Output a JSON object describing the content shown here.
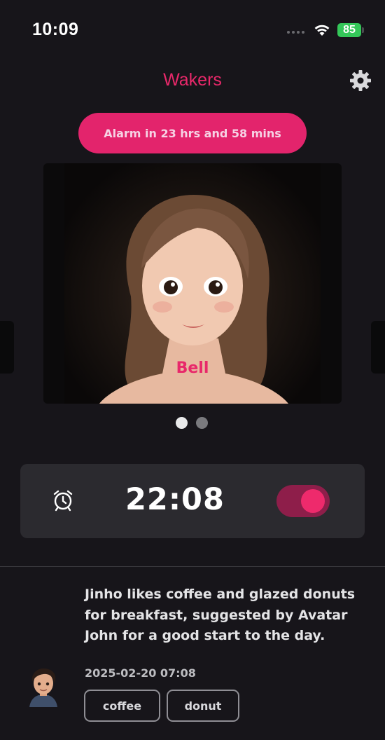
{
  "status_bar": {
    "time": "10:09",
    "battery": "85"
  },
  "header": {
    "title": "Wakers",
    "settings_icon": "gear-icon"
  },
  "alarm_banner": {
    "label": "Alarm in 23 hrs and 58 mins"
  },
  "carousel": {
    "current_avatar_name": "Bell",
    "page_count": 2,
    "active_page": 1
  },
  "alarm": {
    "time": "22:08",
    "enabled": true,
    "icon": "alarm-clock-icon"
  },
  "feed": {
    "text": "Jinho likes coffee and glazed donuts for breakfast, suggested by Avatar John for a good start to the day.",
    "timestamp": "2025-02-20 07:08",
    "tags": [
      "coffee",
      "donut"
    ]
  },
  "colors": {
    "accent": "#e8286a",
    "background": "#17151a",
    "card": "#2b2a2f",
    "battery": "#34c759"
  }
}
